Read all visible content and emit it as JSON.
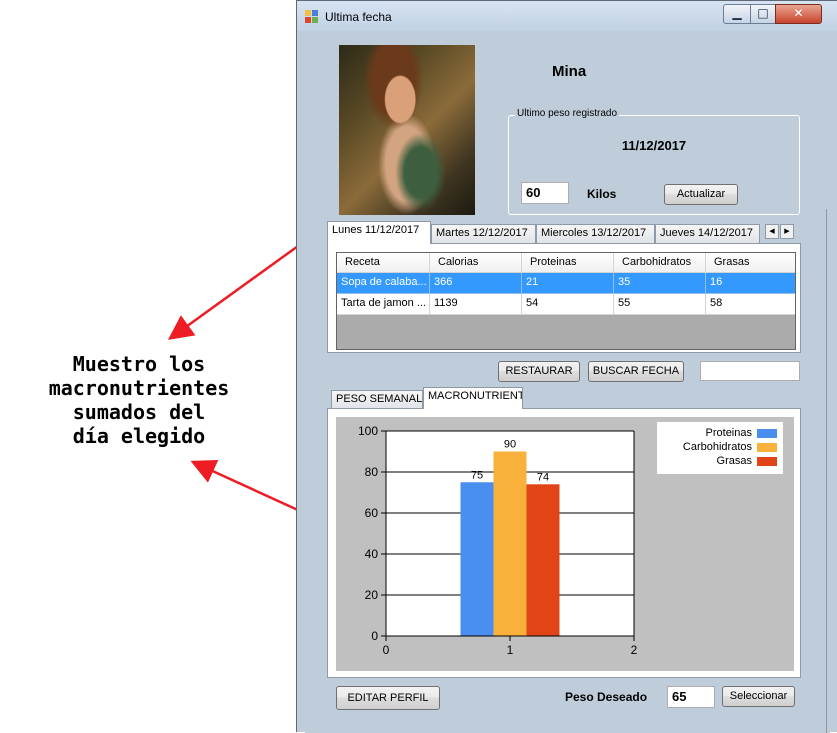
{
  "annotation": {
    "lines": [
      "Muestro los",
      "macronutrientes",
      "sumados del",
      "día elegido"
    ]
  },
  "window": {
    "title": "Ultima fecha",
    "minimize_glyph": "▁",
    "maximize_glyph": "□",
    "close_glyph": "✕"
  },
  "profile": {
    "name": "Mina",
    "image_icon": "portrait-painting"
  },
  "last_weight": {
    "group_title": "Ultimo peso registrado",
    "date": "11/12/2017",
    "weight_value": "60",
    "unit_label": "Kilos",
    "update_button": "Actualizar"
  },
  "day_tabs": {
    "items": [
      "Lunes 11/12/2017",
      "Martes 12/12/2017",
      "Miercoles 13/12/2017",
      "Jueves 14/12/2017"
    ],
    "active_index": 0,
    "scroll_left": "◀",
    "scroll_right": "▶"
  },
  "recipes_table": {
    "columns": [
      "Receta",
      "Calorias",
      "Proteinas",
      "Carbohidratos",
      "Grasas"
    ],
    "rows": [
      {
        "receta": "Sopa de calaba...",
        "calorias": "366",
        "proteinas": "21",
        "carbohidratos": "35",
        "grasas": "16",
        "selected": true
      },
      {
        "receta": "Tarta de jamon ...",
        "calorias": "1139",
        "proteinas": "54",
        "carbohidratos": "55",
        "grasas": "58",
        "selected": false
      }
    ]
  },
  "actions": {
    "restore_button": "RESTAURAR",
    "search_date_button": "BUSCAR FECHA",
    "date_input_value": ""
  },
  "chart_tabs": {
    "items": [
      "PESO SEMANAL",
      "MACRONUTRIENT"
    ],
    "active_index": 1
  },
  "chart_data": {
    "type": "bar",
    "x": [
      1
    ],
    "series": [
      {
        "name": "Proteinas",
        "values": [
          75
        ],
        "color": "#4a8ef0"
      },
      {
        "name": "Carbohidratos",
        "values": [
          90
        ],
        "color": "#f9b13b"
      },
      {
        "name": "Grasas",
        "values": [
          74
        ],
        "color": "#e04417"
      }
    ],
    "xlim": [
      0,
      2
    ],
    "ylim": [
      0,
      100
    ],
    "xticks": [
      0,
      1,
      2
    ],
    "yticks": [
      0,
      20,
      40,
      60,
      80,
      100
    ],
    "grid": "horizontal",
    "legend_position": "top-right",
    "title": "",
    "xlabel": "",
    "ylabel": ""
  },
  "footer": {
    "edit_profile_button": "EDITAR PERFIL",
    "goal_label": "Peso Deseado",
    "goal_value": "65",
    "select_button": "Seleccionar"
  }
}
